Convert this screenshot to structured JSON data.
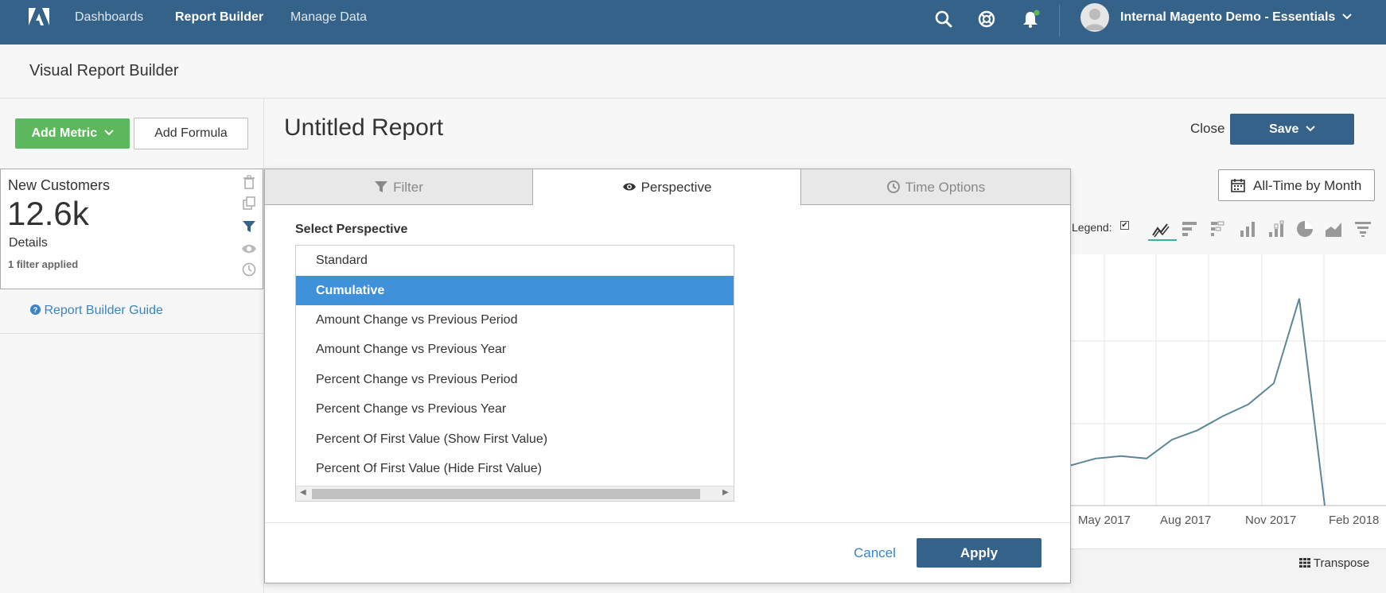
{
  "nav": {
    "links": [
      "Dashboards",
      "Report Builder",
      "Manage Data"
    ],
    "account": "Internal Magento Demo - Essentials"
  },
  "page": {
    "title": "Visual Report Builder"
  },
  "sidebar": {
    "add_metric": "Add Metric",
    "add_formula": "Add Formula",
    "metric": {
      "name": "New Customers",
      "value": "12.6k",
      "details": "Details",
      "filters": "1 filter applied"
    },
    "guide": "Report Builder Guide"
  },
  "report": {
    "title": "Untitled Report",
    "close": "Close",
    "save": "Save",
    "time_range": "All-Time by Month"
  },
  "chart": {
    "legend_label": "Legend:",
    "transpose": "Transpose"
  },
  "chart_data": {
    "type": "line",
    "x_ticks": [
      "May 2017",
      "Aug 2017",
      "Nov 2017",
      "Feb 2018"
    ],
    "series": [
      {
        "values": [
          0.17,
          0.2,
          0.21,
          0.2,
          0.28,
          0.32,
          0.38,
          0.43,
          0.52,
          0.88,
          0.0
        ]
      }
    ],
    "series_color": "#5b8797",
    "ylim": [
      0,
      1
    ],
    "grid": true
  },
  "modal": {
    "tabs": [
      "Filter",
      "Perspective",
      "Time Options"
    ],
    "active_tab": "Perspective",
    "select_label": "Select Perspective",
    "options": [
      "Standard",
      "Cumulative",
      "Amount Change vs Previous Period",
      "Amount Change vs Previous Year",
      "Percent Change vs Previous Period",
      "Percent Change vs Previous Year",
      "Percent Of First Value (Show First Value)",
      "Percent Of First Value (Hide First Value)"
    ],
    "selected": "Cumulative",
    "cancel": "Cancel",
    "apply": "Apply"
  },
  "colors": {
    "nav_bg": "#356289",
    "primary_button": "#356289",
    "add_metric_green": "#5cb85c",
    "selection_blue": "#3f92d9",
    "link_blue": "#3a84c6"
  }
}
